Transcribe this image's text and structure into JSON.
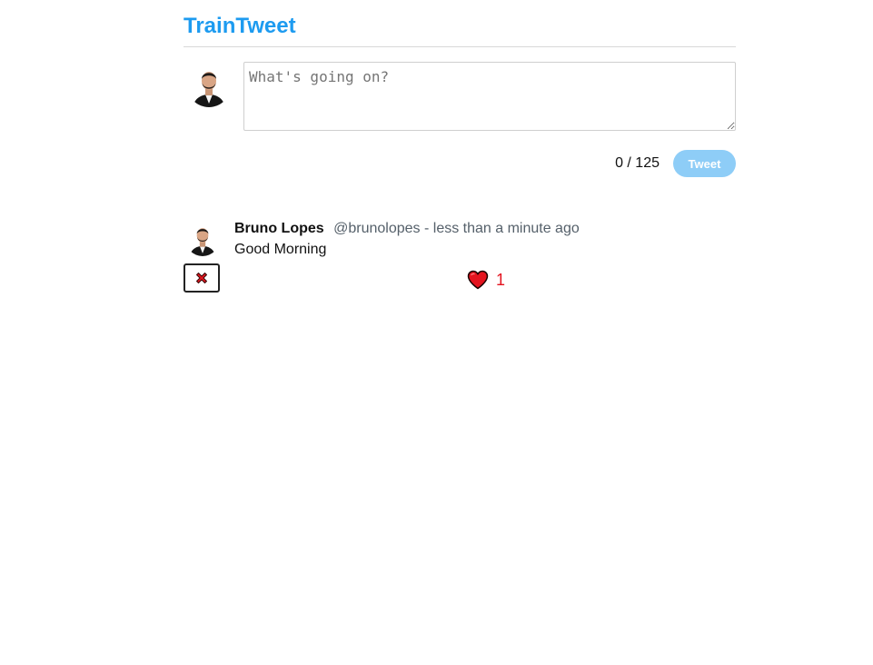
{
  "app": {
    "title": "TrainTweet"
  },
  "compose": {
    "placeholder": "What's going on?",
    "value": "",
    "counter": "0 / 125",
    "button_label": "Tweet",
    "avatar_icon": "user-avatar-icon"
  },
  "tweets": [
    {
      "author_name": "Bruno Lopes",
      "author_meta": "@brunolopes - less than a minute ago",
      "text": "Good Morning",
      "likes": "1",
      "like_icon": "heart-icon",
      "delete_icon": "cross-mark-icon",
      "avatar_icon": "user-avatar-icon"
    }
  ],
  "colors": {
    "brand": "#1d9bf0",
    "tweet_button_disabled": "#8ecdf7",
    "like": "#e3141f",
    "meta_text": "#55606a"
  }
}
